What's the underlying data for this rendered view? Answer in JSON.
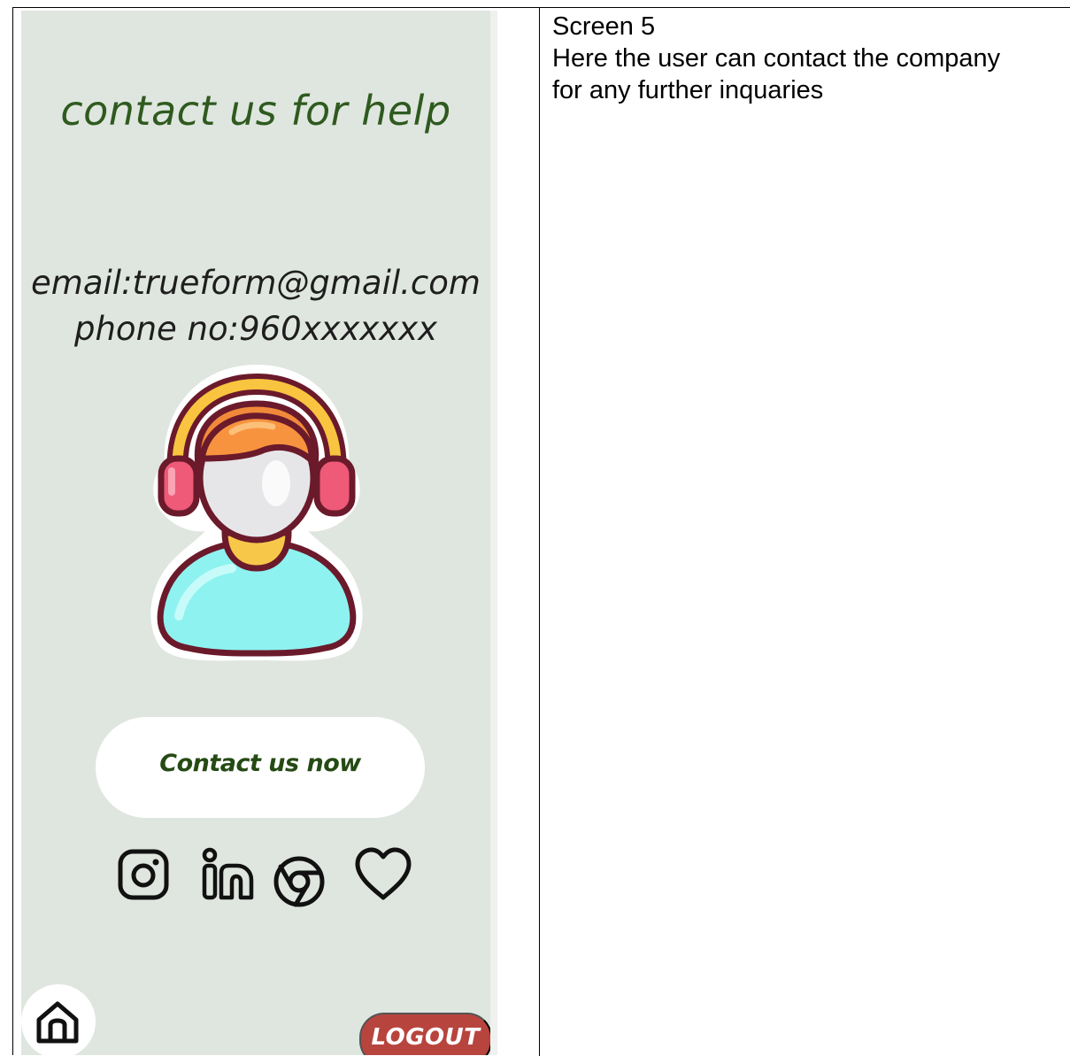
{
  "screen": {
    "title": "contact us for help",
    "email_line": "email:trueform@gmail.com",
    "phone_line": "phone no:960xxxxxxx",
    "contact_button_label": "Contact us now",
    "logout_button_label": "LOGOUT",
    "avatar_icon": "support-agent-headphones-icon",
    "social_icons": [
      "instagram-icon",
      "linkedin-icon",
      "chrome-icon",
      "heart-icon"
    ],
    "home_icon": "home-icon",
    "colors": {
      "screen_background": "#dfe6df",
      "title_green": "#2f5a1f",
      "button_text_green": "#254a14",
      "logout_red": "#b8443e"
    }
  },
  "description": {
    "heading": "Screen 5",
    "line1": "Here the user can contact the company",
    "line2": "for any further inquaries"
  }
}
